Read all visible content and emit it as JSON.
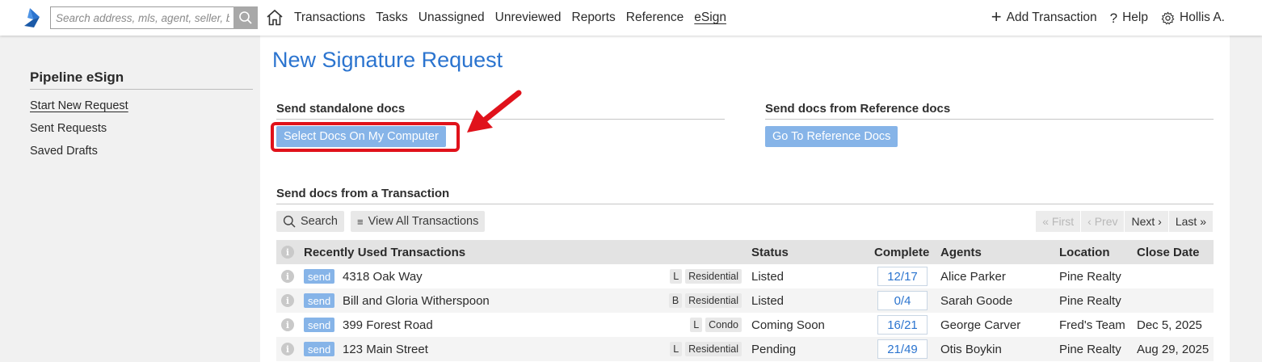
{
  "colors": {
    "accent": "#2b74cf",
    "button_blue": "#86b4e8",
    "highlight_red": "#e0121b"
  },
  "search": {
    "placeholder": "Search address, mls, agent, seller, b"
  },
  "nav": {
    "items": [
      "Transactions",
      "Tasks",
      "Unassigned",
      "Unreviewed",
      "Reports",
      "Reference",
      "eSign"
    ],
    "active": "eSign",
    "add_transaction": "Add Transaction",
    "help": "Help",
    "user": "Hollis A."
  },
  "sidebar": {
    "title": "Pipeline eSign",
    "items": [
      {
        "label": "Start New Request",
        "active": true
      },
      {
        "label": "Sent Requests"
      },
      {
        "label": "Saved Drafts"
      }
    ]
  },
  "main": {
    "title": "New Signature Request",
    "standalone": {
      "heading": "Send standalone docs",
      "button": "Select Docs On My Computer"
    },
    "reference": {
      "heading": "Send docs from Reference docs",
      "button": "Go To Reference Docs"
    },
    "transaction": {
      "heading": "Send docs from a Transaction",
      "search_button": "Search",
      "view_all_button": "View All Transactions",
      "pager": {
        "first": "First",
        "prev": "Prev",
        "next": "Next",
        "last": "Last"
      }
    }
  },
  "table": {
    "headers": {
      "name": "Recently Used Transactions",
      "status": "Status",
      "complete": "Complete",
      "agents": "Agents",
      "location": "Location",
      "close": "Close Date"
    },
    "send_label": "send",
    "rows": [
      {
        "name": "4318 Oak Way",
        "code": "L",
        "type": "Residential",
        "status": "Listed",
        "complete": "12/17",
        "agent": "Alice Parker",
        "location": "Pine Realty",
        "close": ""
      },
      {
        "name": "Bill and Gloria Witherspoon",
        "code": "B",
        "type": "Residential",
        "status": "Listed",
        "complete": "0/4",
        "agent": "Sarah Goode",
        "location": "Pine Realty",
        "close": ""
      },
      {
        "name": "399 Forest Road",
        "code": "L",
        "type": "Condo",
        "status": "Coming Soon",
        "complete": "16/21",
        "agent": "George Carver",
        "location": "Fred's Team",
        "close": "Dec 5, 2025"
      },
      {
        "name": "123 Main Street",
        "code": "L",
        "type": "Residential",
        "status": "Pending",
        "complete": "21/49",
        "agent": "Otis Boykin",
        "location": "Pine Realty",
        "close": "Aug 29, 2025"
      }
    ]
  }
}
